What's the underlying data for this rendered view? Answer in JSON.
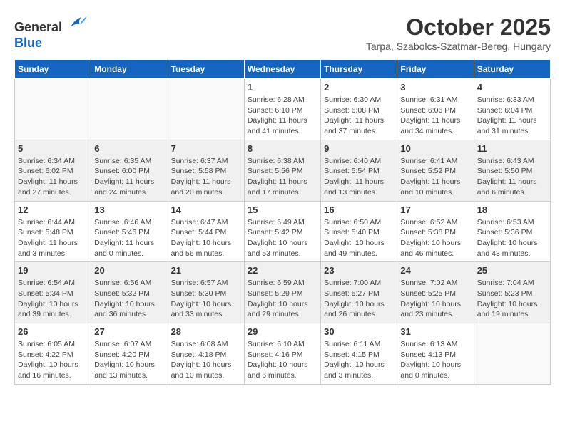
{
  "header": {
    "logo_line1": "General",
    "logo_line2": "Blue",
    "month_title": "October 2025",
    "location": "Tarpa, Szabolcs-Szatmar-Bereg, Hungary"
  },
  "days_of_week": [
    "Sunday",
    "Monday",
    "Tuesday",
    "Wednesday",
    "Thursday",
    "Friday",
    "Saturday"
  ],
  "weeks": [
    [
      {
        "day": "",
        "info": ""
      },
      {
        "day": "",
        "info": ""
      },
      {
        "day": "",
        "info": ""
      },
      {
        "day": "1",
        "info": "Sunrise: 6:28 AM\nSunset: 6:10 PM\nDaylight: 11 hours\nand 41 minutes."
      },
      {
        "day": "2",
        "info": "Sunrise: 6:30 AM\nSunset: 6:08 PM\nDaylight: 11 hours\nand 37 minutes."
      },
      {
        "day": "3",
        "info": "Sunrise: 6:31 AM\nSunset: 6:06 PM\nDaylight: 11 hours\nand 34 minutes."
      },
      {
        "day": "4",
        "info": "Sunrise: 6:33 AM\nSunset: 6:04 PM\nDaylight: 11 hours\nand 31 minutes."
      }
    ],
    [
      {
        "day": "5",
        "info": "Sunrise: 6:34 AM\nSunset: 6:02 PM\nDaylight: 11 hours\nand 27 minutes."
      },
      {
        "day": "6",
        "info": "Sunrise: 6:35 AM\nSunset: 6:00 PM\nDaylight: 11 hours\nand 24 minutes."
      },
      {
        "day": "7",
        "info": "Sunrise: 6:37 AM\nSunset: 5:58 PM\nDaylight: 11 hours\nand 20 minutes."
      },
      {
        "day": "8",
        "info": "Sunrise: 6:38 AM\nSunset: 5:56 PM\nDaylight: 11 hours\nand 17 minutes."
      },
      {
        "day": "9",
        "info": "Sunrise: 6:40 AM\nSunset: 5:54 PM\nDaylight: 11 hours\nand 13 minutes."
      },
      {
        "day": "10",
        "info": "Sunrise: 6:41 AM\nSunset: 5:52 PM\nDaylight: 11 hours\nand 10 minutes."
      },
      {
        "day": "11",
        "info": "Sunrise: 6:43 AM\nSunset: 5:50 PM\nDaylight: 11 hours\nand 6 minutes."
      }
    ],
    [
      {
        "day": "12",
        "info": "Sunrise: 6:44 AM\nSunset: 5:48 PM\nDaylight: 11 hours\nand 3 minutes."
      },
      {
        "day": "13",
        "info": "Sunrise: 6:46 AM\nSunset: 5:46 PM\nDaylight: 11 hours\nand 0 minutes."
      },
      {
        "day": "14",
        "info": "Sunrise: 6:47 AM\nSunset: 5:44 PM\nDaylight: 10 hours\nand 56 minutes."
      },
      {
        "day": "15",
        "info": "Sunrise: 6:49 AM\nSunset: 5:42 PM\nDaylight: 10 hours\nand 53 minutes."
      },
      {
        "day": "16",
        "info": "Sunrise: 6:50 AM\nSunset: 5:40 PM\nDaylight: 10 hours\nand 49 minutes."
      },
      {
        "day": "17",
        "info": "Sunrise: 6:52 AM\nSunset: 5:38 PM\nDaylight: 10 hours\nand 46 minutes."
      },
      {
        "day": "18",
        "info": "Sunrise: 6:53 AM\nSunset: 5:36 PM\nDaylight: 10 hours\nand 43 minutes."
      }
    ],
    [
      {
        "day": "19",
        "info": "Sunrise: 6:54 AM\nSunset: 5:34 PM\nDaylight: 10 hours\nand 39 minutes."
      },
      {
        "day": "20",
        "info": "Sunrise: 6:56 AM\nSunset: 5:32 PM\nDaylight: 10 hours\nand 36 minutes."
      },
      {
        "day": "21",
        "info": "Sunrise: 6:57 AM\nSunset: 5:30 PM\nDaylight: 10 hours\nand 33 minutes."
      },
      {
        "day": "22",
        "info": "Sunrise: 6:59 AM\nSunset: 5:29 PM\nDaylight: 10 hours\nand 29 minutes."
      },
      {
        "day": "23",
        "info": "Sunrise: 7:00 AM\nSunset: 5:27 PM\nDaylight: 10 hours\nand 26 minutes."
      },
      {
        "day": "24",
        "info": "Sunrise: 7:02 AM\nSunset: 5:25 PM\nDaylight: 10 hours\nand 23 minutes."
      },
      {
        "day": "25",
        "info": "Sunrise: 7:04 AM\nSunset: 5:23 PM\nDaylight: 10 hours\nand 19 minutes."
      }
    ],
    [
      {
        "day": "26",
        "info": "Sunrise: 6:05 AM\nSunset: 4:22 PM\nDaylight: 10 hours\nand 16 minutes."
      },
      {
        "day": "27",
        "info": "Sunrise: 6:07 AM\nSunset: 4:20 PM\nDaylight: 10 hours\nand 13 minutes."
      },
      {
        "day": "28",
        "info": "Sunrise: 6:08 AM\nSunset: 4:18 PM\nDaylight: 10 hours\nand 10 minutes."
      },
      {
        "day": "29",
        "info": "Sunrise: 6:10 AM\nSunset: 4:16 PM\nDaylight: 10 hours\nand 6 minutes."
      },
      {
        "day": "30",
        "info": "Sunrise: 6:11 AM\nSunset: 4:15 PM\nDaylight: 10 hours\nand 3 minutes."
      },
      {
        "day": "31",
        "info": "Sunrise: 6:13 AM\nSunset: 4:13 PM\nDaylight: 10 hours\nand 0 minutes."
      },
      {
        "day": "",
        "info": ""
      }
    ]
  ]
}
